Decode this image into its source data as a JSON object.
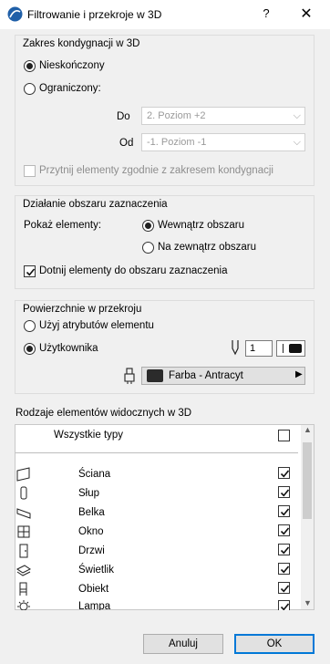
{
  "window": {
    "title": "Filtrowanie i przekroje w 3D",
    "help": "?",
    "close": "✕"
  },
  "kondygnacje": {
    "title": "Zakres kondygnacji w 3D",
    "opt_infinite": "Nieskończony",
    "opt_limited": "Ograniczony:",
    "to_label": "Do",
    "to_value": "2. Poziom +2",
    "from_label": "Od",
    "from_value": "-1. Poziom -1",
    "trim_label": "Przytnij elementy zgodnie z zakresem kondygnacji"
  },
  "zaznaczenie": {
    "title": "Działanie obszaru zaznaczenia",
    "show_label": "Pokaż elementy:",
    "opt_inside": "Wewnątrz obszaru",
    "opt_outside": "Na zewnątrz obszaru",
    "trim_label": "Dotnij elementy do obszaru zaznaczenia"
  },
  "powierzchnie": {
    "title": "Powierzchnie w przekroju",
    "opt_element": "Użyj atrybutów elementu",
    "opt_user": "Użytkownika",
    "pen_value": "1",
    "fill_label": "Farba - Antracyt"
  },
  "types": {
    "title": "Rodzaje elementów widocznych w 3D",
    "all_label": "Wszystkie typy",
    "items": [
      {
        "label": "Ściana",
        "icon": "wall-icon"
      },
      {
        "label": "Słup",
        "icon": "column-icon"
      },
      {
        "label": "Belka",
        "icon": "beam-icon"
      },
      {
        "label": "Okno",
        "icon": "window-icon"
      },
      {
        "label": "Drzwi",
        "icon": "door-icon"
      },
      {
        "label": "Świetlik",
        "icon": "skylight-icon"
      },
      {
        "label": "Obiekt",
        "icon": "object-icon"
      },
      {
        "label": "Lampa",
        "icon": "lamp-icon"
      }
    ]
  },
  "buttons": {
    "cancel": "Anuluj",
    "ok": "OK"
  },
  "colors": {
    "accent": "#0078d7",
    "fill_swatch": "#2b2b2b"
  }
}
